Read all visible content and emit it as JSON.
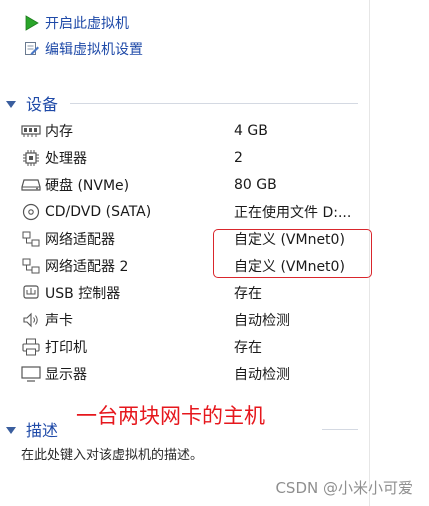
{
  "actions": [
    {
      "label": "开启此虚拟机",
      "icon": "play-icon"
    },
    {
      "label": "编辑虚拟机设置",
      "icon": "edit-settings-icon"
    }
  ],
  "devices_section": {
    "title": "设备"
  },
  "devices": [
    {
      "name": "内存",
      "value": "4 GB",
      "icon": "memory-icon"
    },
    {
      "name": "处理器",
      "value": "2",
      "icon": "processor-icon"
    },
    {
      "name": "硬盘 (NVMe)",
      "value": "80 GB",
      "icon": "hard-disk-icon"
    },
    {
      "name": "CD/DVD (SATA)",
      "value": "正在使用文件 D:...",
      "icon": "cd-dvd-icon"
    },
    {
      "name": "网络适配器",
      "value": "自定义 (VMnet0)",
      "icon": "network-adapter-icon"
    },
    {
      "name": "网络适配器 2",
      "value": "自定义 (VMnet0)",
      "icon": "network-adapter-icon"
    },
    {
      "name": "USB 控制器",
      "value": "存在",
      "icon": "usb-icon"
    },
    {
      "name": "声卡",
      "value": "自动检测",
      "icon": "sound-card-icon"
    },
    {
      "name": "打印机",
      "value": "存在",
      "icon": "printer-icon"
    },
    {
      "name": "显示器",
      "value": "自动检测",
      "icon": "monitor-icon"
    }
  ],
  "annotation": {
    "text": "一台两块网卡的主机",
    "color": "#e6171d"
  },
  "description_section": {
    "title": "描述",
    "placeholder": "在此处键入对该虚拟机的描述。"
  },
  "watermark": "CSDN @小米小可爱"
}
